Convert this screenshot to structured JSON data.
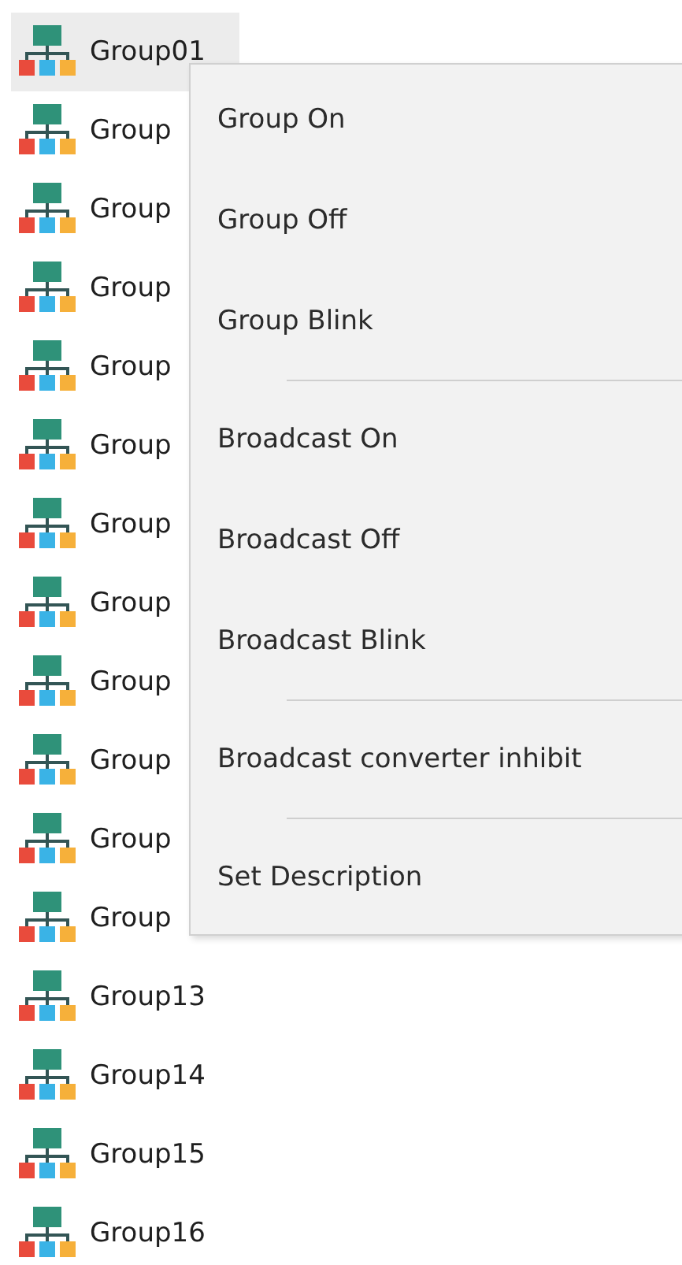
{
  "groups": [
    {
      "label": "Group01",
      "selected": true
    },
    {
      "label": "Group",
      "selected": false
    },
    {
      "label": "Group",
      "selected": false
    },
    {
      "label": "Group",
      "selected": false
    },
    {
      "label": "Group",
      "selected": false
    },
    {
      "label": "Group",
      "selected": false
    },
    {
      "label": "Group",
      "selected": false
    },
    {
      "label": "Group",
      "selected": false
    },
    {
      "label": "Group",
      "selected": false
    },
    {
      "label": "Group",
      "selected": false
    },
    {
      "label": "Group",
      "selected": false
    },
    {
      "label": "Group",
      "selected": false
    },
    {
      "label": "Group13",
      "selected": false
    },
    {
      "label": "Group14",
      "selected": false
    },
    {
      "label": "Group15",
      "selected": false
    },
    {
      "label": "Group16",
      "selected": false
    }
  ],
  "context_menu": [
    {
      "kind": "item",
      "label": "Group On"
    },
    {
      "kind": "item",
      "label": "Group Off"
    },
    {
      "kind": "item",
      "label": "Group Blink"
    },
    {
      "kind": "separator"
    },
    {
      "kind": "item",
      "label": "Broadcast On"
    },
    {
      "kind": "item",
      "label": "Broadcast Off"
    },
    {
      "kind": "item",
      "label": "Broadcast Blink"
    },
    {
      "kind": "separator"
    },
    {
      "kind": "item",
      "label": "Broadcast converter inhibit"
    },
    {
      "kind": "separator"
    },
    {
      "kind": "item",
      "label": "Set Description"
    }
  ]
}
